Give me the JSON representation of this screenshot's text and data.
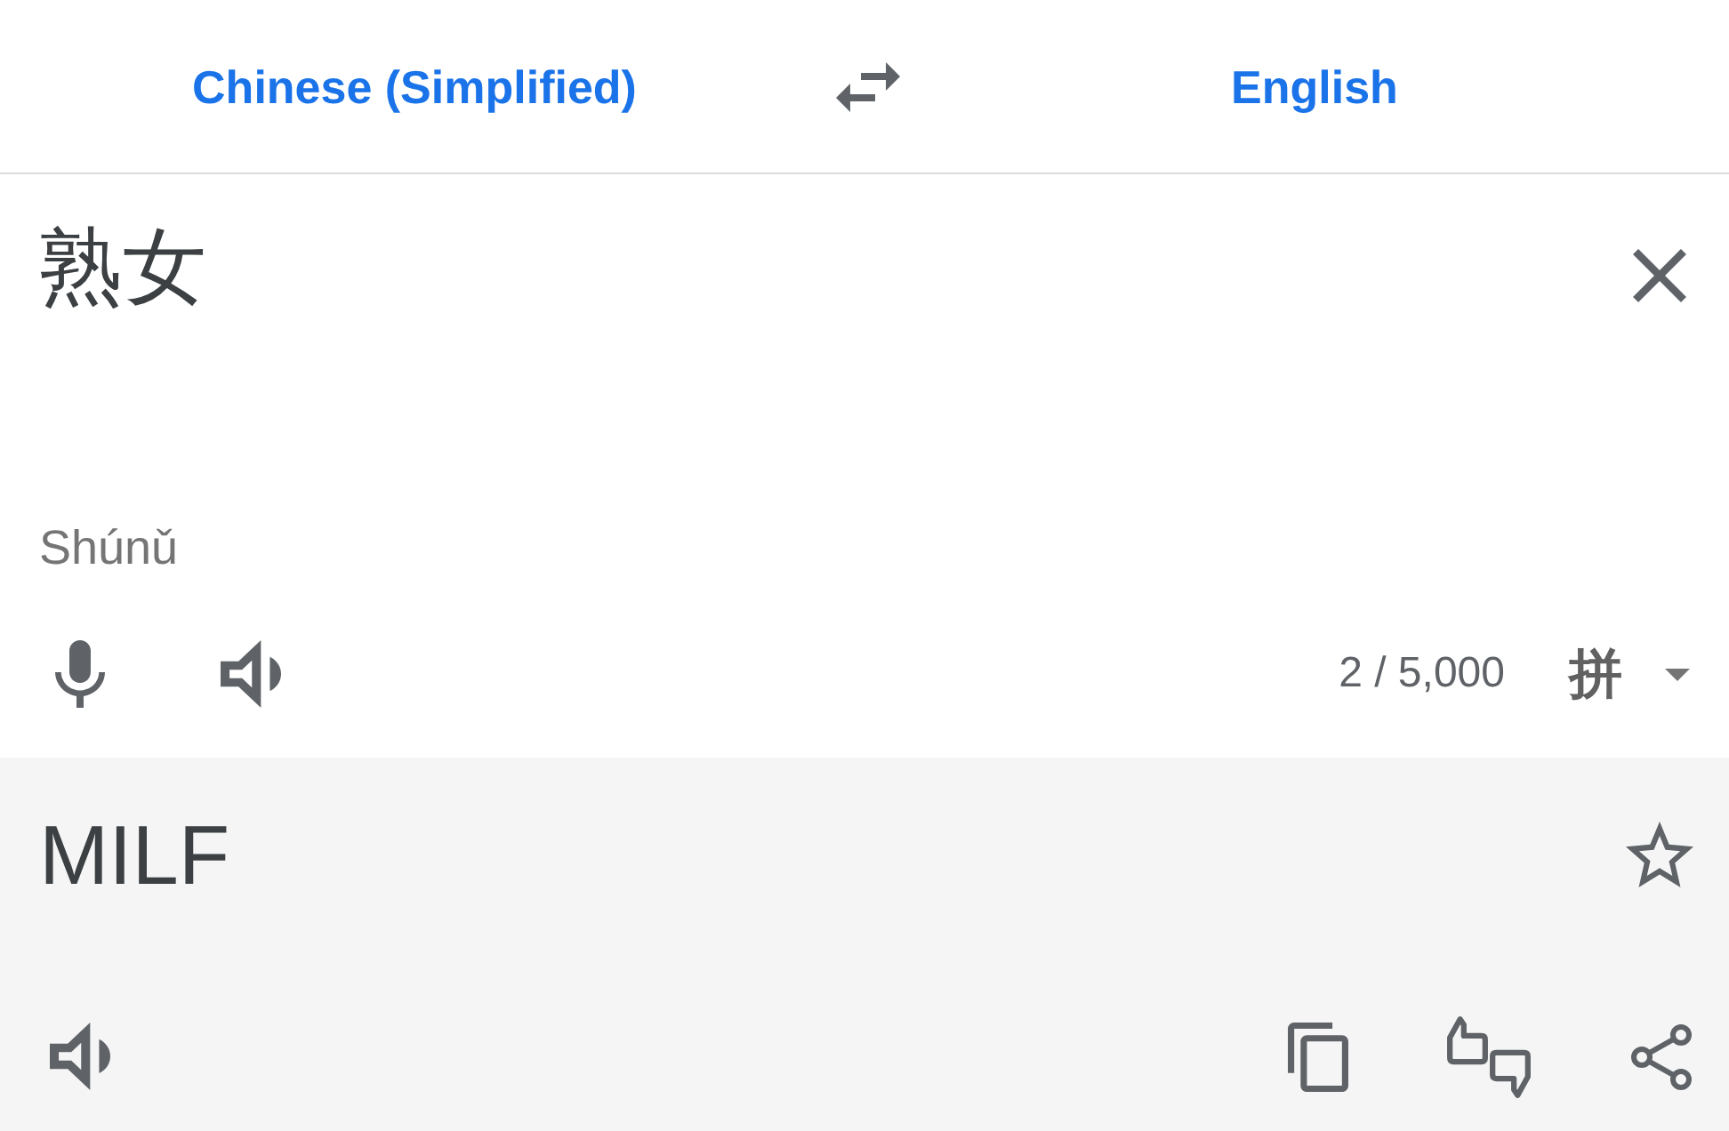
{
  "languages": {
    "source": "Chinese (Simplified)",
    "target": "English"
  },
  "input": {
    "text": "熟女",
    "romanization": "Shúnǔ",
    "character_count": "2 / 5,000",
    "input_method": "拼"
  },
  "output": {
    "text": "MILF",
    "saved": false
  }
}
